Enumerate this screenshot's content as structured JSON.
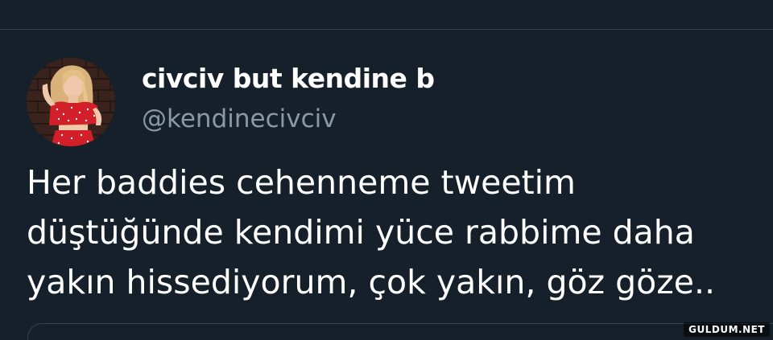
{
  "tweet": {
    "author": {
      "display_name": "civciv but kendine b",
      "handle": "@kendinecivciv",
      "avatar": "profile-photo"
    },
    "text_lines": [
      "Her baddies cehenneme tweetim",
      "düştüğünde kendimi yüce rabbime daha",
      "yakın hissediyorum, çok yakın, göz göze.."
    ]
  },
  "watermark": "GULDUM.NET",
  "colors": {
    "background": "#15202b",
    "primary_text": "#ffffff",
    "secondary_text": "#8b98a5",
    "divider": "#38444d"
  }
}
